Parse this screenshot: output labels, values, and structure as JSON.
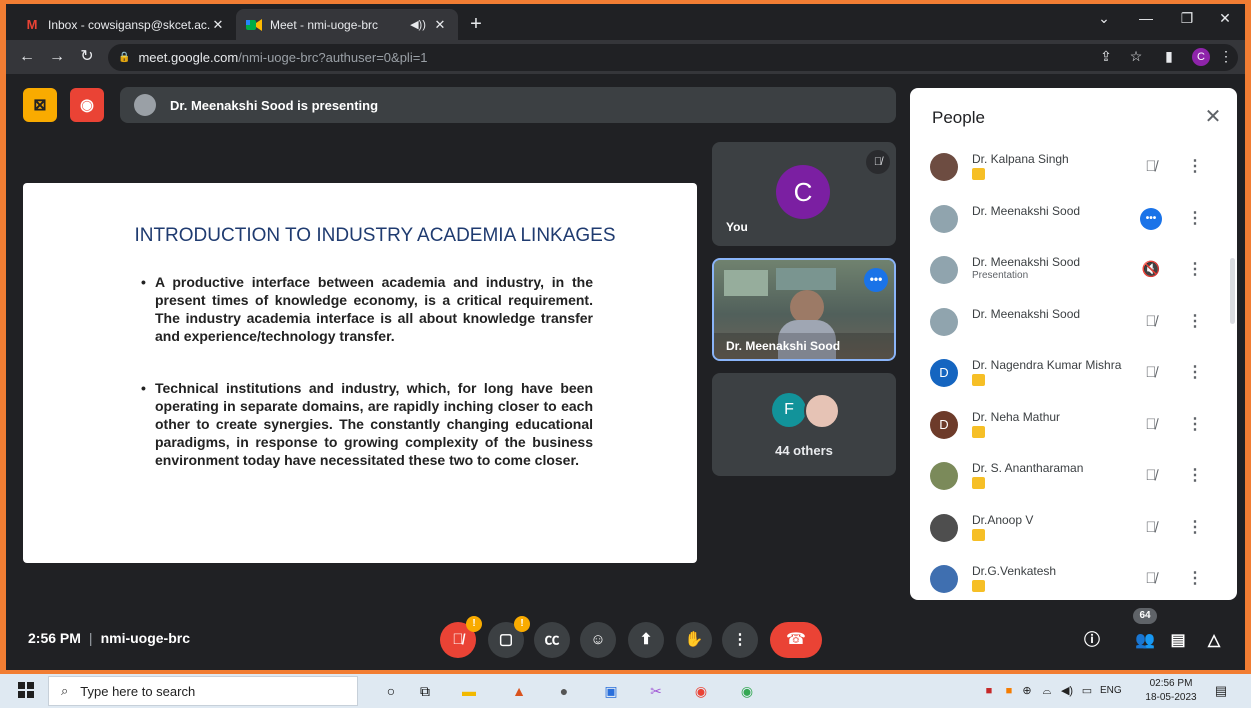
{
  "browser": {
    "tabs": [
      {
        "title": "Inbox - cowsigansp@skcet.ac.in -",
        "icon": "gmail-icon"
      },
      {
        "title": "Meet - nmi-uoge-brc",
        "icon": "meet-icon"
      }
    ],
    "url_host": "meet.google.com",
    "url_path": "/nmi-uoge-brc?authuser=0&pli=1",
    "profile_initial": "C"
  },
  "meet": {
    "presenting_text": "Dr. Meenakshi Sood is presenting",
    "slide": {
      "title": "INTRODUCTION TO INDUSTRY ACADEMIA LINKAGES",
      "bullets": [
        "A productive interface between academia and industry, in the present times of knowledge economy, is a critical requirement. The industry academia interface is all about knowledge transfer and experience/technology transfer.",
        "Technical institutions and industry, which, for long have been operating in separate domains, are rapidly inching closer to each other to create synergies. The constantly changing educational paradigms, in response to growing complexity of the business environment today have necessitated these two to come closer."
      ]
    },
    "tiles": {
      "you_initial": "C",
      "you_label": "You",
      "presenter_label": "Dr. Meenakshi Sood",
      "others_initial": "F",
      "others_label": "44 others"
    },
    "people_panel": {
      "title": "People",
      "participants": [
        {
          "name": "Dr. Kalpana Singh",
          "sub": "",
          "badge": true,
          "avatar": "photo",
          "avatar_color": "#6d4c41",
          "initial": "",
          "mic": "muted"
        },
        {
          "name": "Dr. Meenakshi Sood",
          "sub": "",
          "badge": false,
          "avatar": "photo",
          "avatar_color": "#90a4ae",
          "initial": "",
          "mic": "speaking"
        },
        {
          "name": "Dr. Meenakshi Sood",
          "sub": "Presentation",
          "badge": false,
          "avatar": "photo",
          "avatar_color": "#90a4ae",
          "initial": "",
          "mic": "audio-off"
        },
        {
          "name": "Dr. Meenakshi Sood",
          "sub": "",
          "badge": false,
          "avatar": "photo",
          "avatar_color": "#90a4ae",
          "initial": "",
          "mic": "muted"
        },
        {
          "name": "Dr. Nagendra Kumar Mishra",
          "sub": "",
          "badge": true,
          "avatar": "initial",
          "avatar_color": "#1565c0",
          "initial": "D",
          "mic": "muted"
        },
        {
          "name": "Dr. Neha Mathur",
          "sub": "",
          "badge": true,
          "avatar": "initial",
          "avatar_color": "#6d3b2a",
          "initial": "D",
          "mic": "muted"
        },
        {
          "name": "Dr. S. Anantharaman",
          "sub": "",
          "badge": true,
          "avatar": "photo",
          "avatar_color": "#7b8a5a",
          "initial": "",
          "mic": "muted"
        },
        {
          "name": "Dr.Anoop V",
          "sub": "",
          "badge": true,
          "avatar": "photo",
          "avatar_color": "#4e4e4e",
          "initial": "",
          "mic": "muted"
        },
        {
          "name": "Dr.G.Venkatesh",
          "sub": "",
          "badge": true,
          "avatar": "photo",
          "avatar_color": "#3f6fb0",
          "initial": "",
          "mic": "muted"
        }
      ]
    },
    "bottom": {
      "time": "2:56 PM",
      "meeting_code": "nmi-uoge-brc",
      "participant_count": "64"
    }
  },
  "taskbar": {
    "search_placeholder": "Type here to search",
    "language": "ENG",
    "time": "02:56 PM",
    "date": "18-05-2023"
  },
  "colors": {
    "meet_bg": "#202124",
    "accent_blue": "#1a73e8",
    "end_call_red": "#ea4335",
    "frame_orange": "#f17d33"
  }
}
